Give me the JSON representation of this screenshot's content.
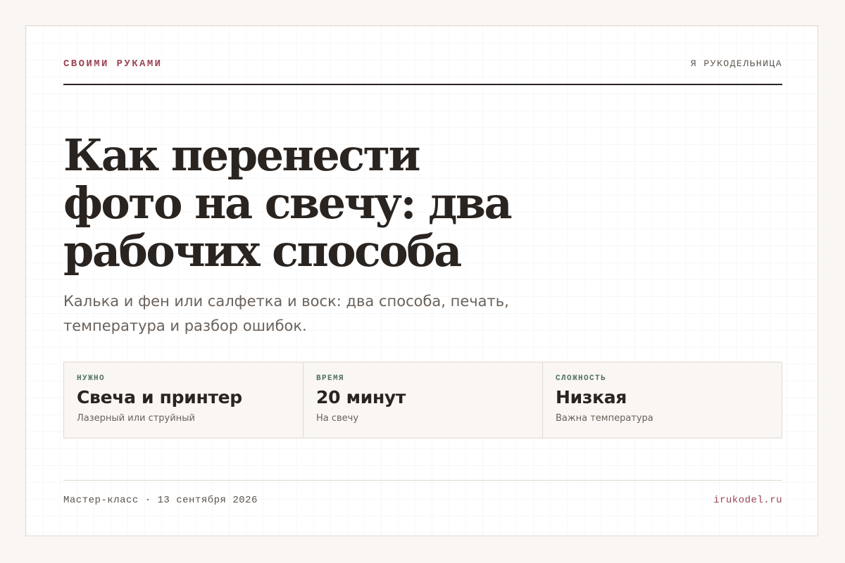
{
  "header": {
    "section": "Своими руками",
    "site_name": "Я рукодельница"
  },
  "article": {
    "title": "Как перенести фото на свечу: два рабочих способа",
    "subtitle": "Калька и фен или салфетка и воск: два способа, печать, температура и разбор ошибок."
  },
  "facts": [
    {
      "label": "Нужно",
      "value": "Свеча и принтер",
      "note": "Лазерный или струйный"
    },
    {
      "label": "Время",
      "value": "20 минут",
      "note": "На свечу"
    },
    {
      "label": "Сложность",
      "value": "Низкая",
      "note": "Важна температура"
    }
  ],
  "footer": {
    "meta": "Мастер-класс · 13 сентября 2026",
    "site": "irukodel.ru"
  },
  "colors": {
    "accent": "#9a4656",
    "label_green": "#4f7060",
    "text_dark": "#2a2420",
    "text_muted": "#6a615a"
  }
}
